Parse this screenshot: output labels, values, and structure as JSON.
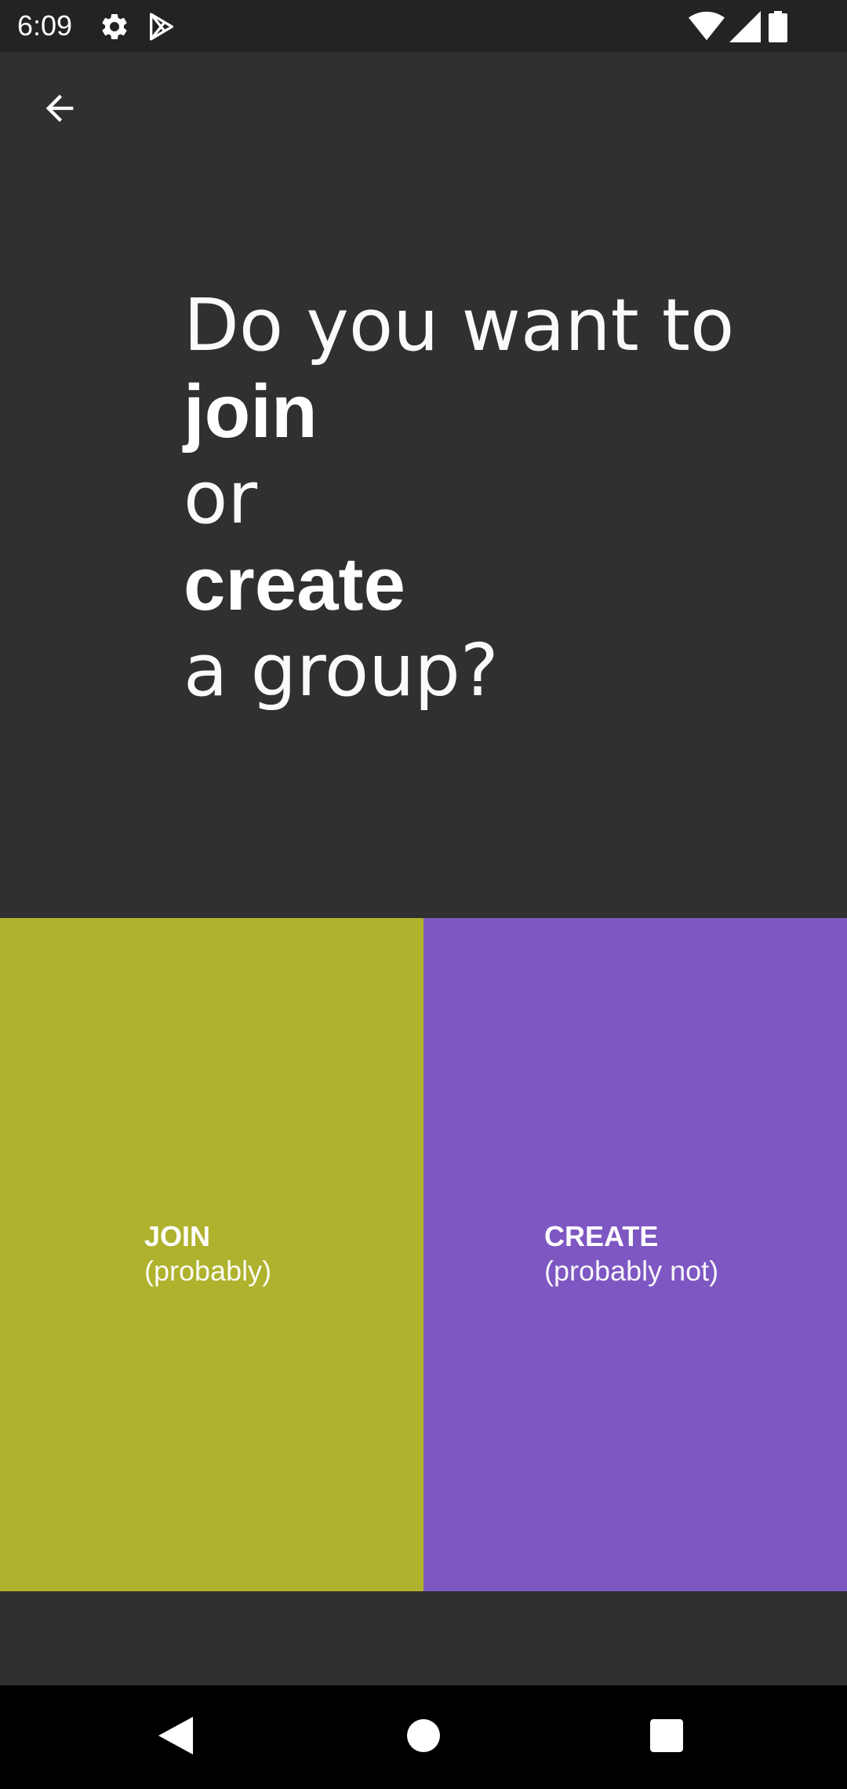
{
  "status_bar": {
    "time": "6:09",
    "left_icons": [
      "gear-icon",
      "play-store-icon"
    ],
    "right_icons": [
      "wifi-icon",
      "signal-icon",
      "battery-icon"
    ]
  },
  "toolbar": {
    "back_icon": "arrow-back-icon"
  },
  "question": {
    "line1": "Do you want to",
    "line2": "join",
    "line3": "or",
    "line4": "create",
    "line5": "a group?"
  },
  "choices": {
    "join": {
      "title": "JOIN",
      "subtitle": "(probably)",
      "color": "#afb22d"
    },
    "create": {
      "title": "CREATE",
      "subtitle": "(probably not)",
      "color": "#7e57c2"
    }
  },
  "nav_bar": {
    "buttons": [
      "back-triangle-icon",
      "home-circle-icon",
      "recents-square-icon"
    ]
  },
  "colors": {
    "background": "#303030",
    "status_bar": "#232323",
    "nav_bar": "#000000"
  }
}
